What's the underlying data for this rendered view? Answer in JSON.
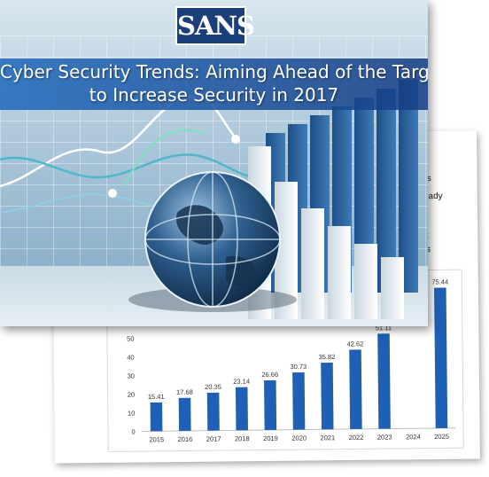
{
  "slide": {
    "logo_text": "SANS",
    "title_line1": "Cyber Security Trends: Aiming Ahead of the Target",
    "title_line2": "to Increase Security in 2017"
  },
  "back_page": {
    "snippets": [
      "ngs",
      "already",
      "at",
      "us"
    ]
  },
  "colors": {
    "bar": "#1f5fb4",
    "logo_bg": "#1b3f7a",
    "title_band": "#2a6ab8"
  },
  "icons": [
    "globe-icon"
  ],
  "chart_data": {
    "type": "bar",
    "categories": [
      "2015",
      "2016",
      "2017",
      "2018",
      "2019",
      "2020",
      "2021",
      "2022",
      "2023",
      "2024",
      "2025"
    ],
    "values": [
      15.41,
      17.68,
      20.35,
      23.14,
      26.66,
      30.73,
      35.82,
      42.62,
      51.11,
      null,
      75.44
    ],
    "value_labels": [
      "15.41",
      "17.68",
      "20.35",
      "23.14",
      "26.66",
      "30.73",
      "35.82",
      "42.62",
      "51.11",
      "",
      "75.44"
    ],
    "yticks": [
      "0",
      "10",
      "20",
      "30",
      "40",
      "50"
    ],
    "ylim": [
      0,
      80
    ],
    "grid": false
  }
}
